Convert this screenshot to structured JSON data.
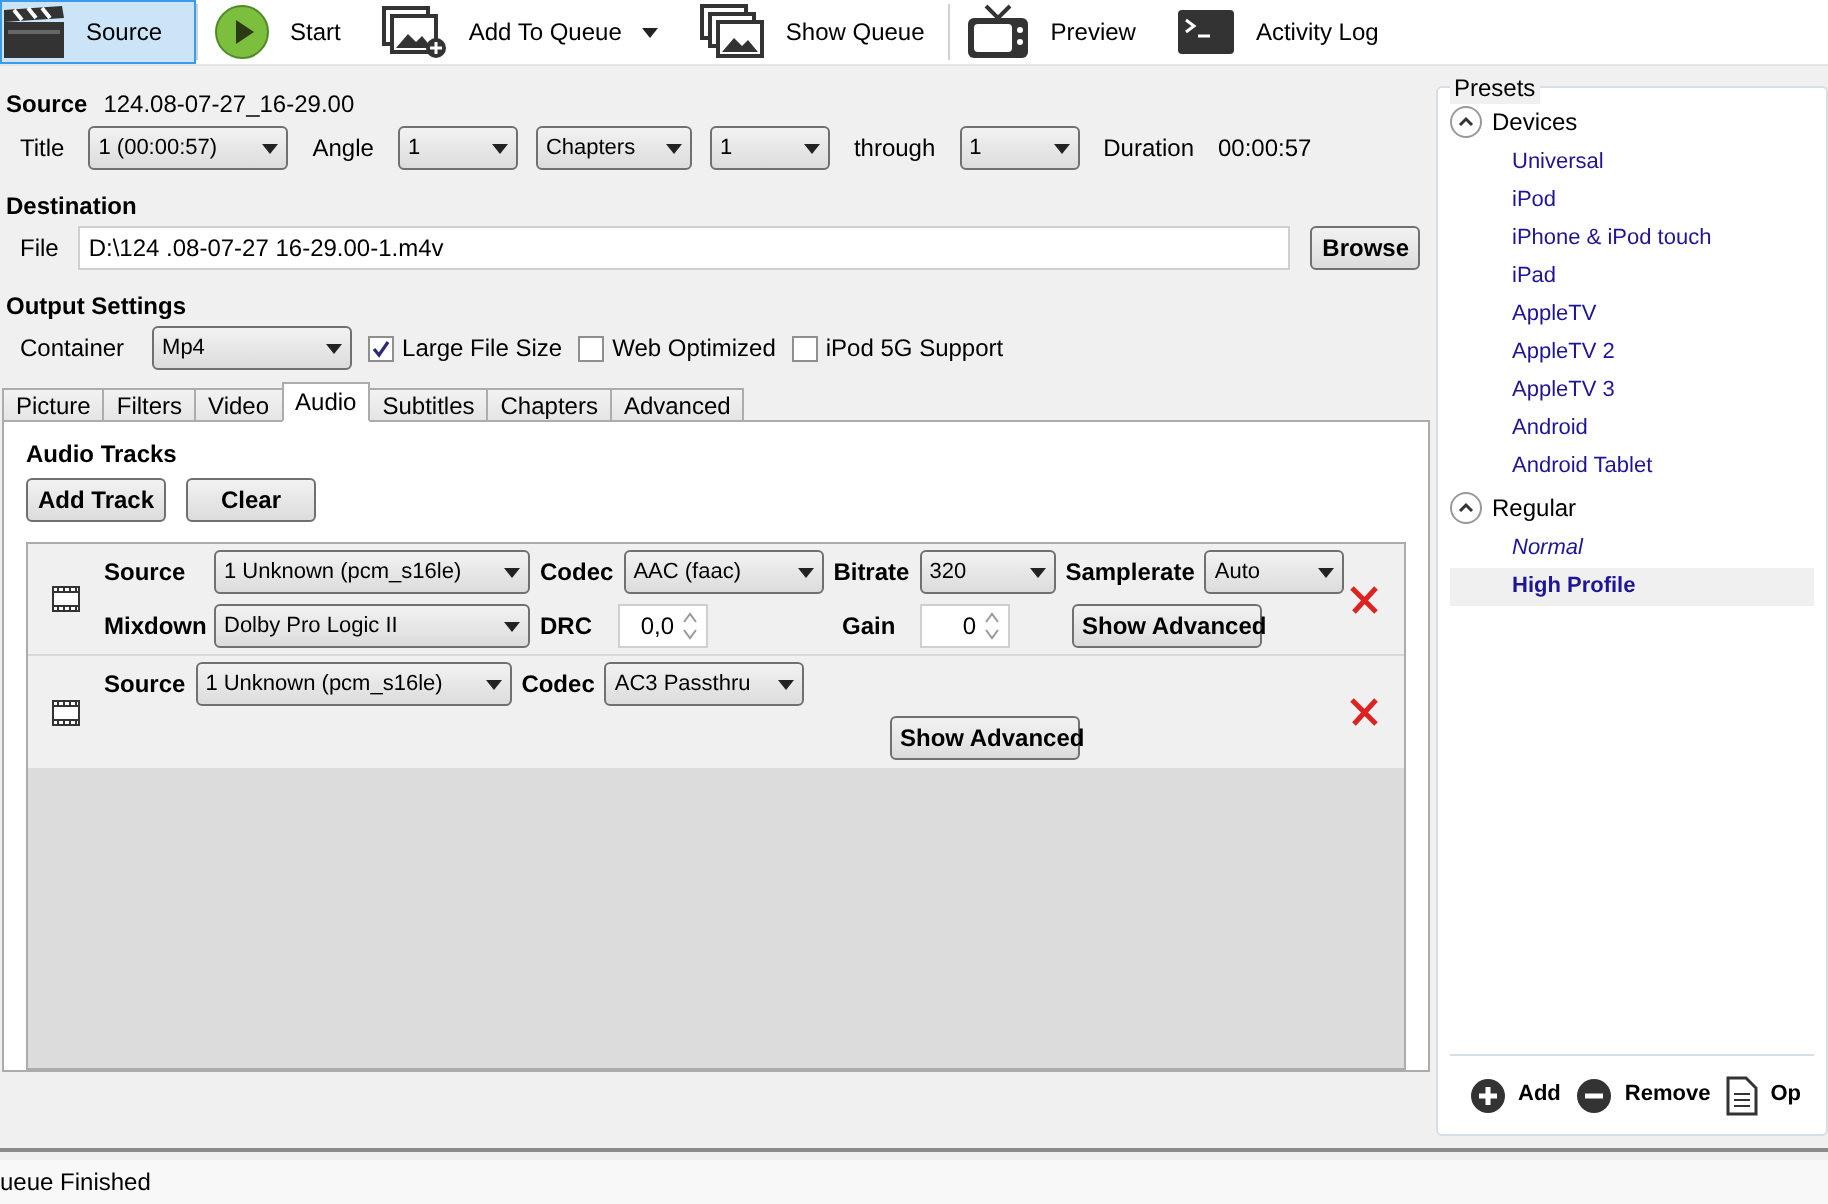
{
  "toolbar": [
    {
      "kind": "source",
      "label": "Source",
      "selected": true,
      "dropdown": false
    },
    {
      "kind": "start",
      "label": "Start",
      "selected": false,
      "dropdown": false
    },
    {
      "kind": "add_queue",
      "label": "Add To Queue",
      "selected": false,
      "dropdown": true
    },
    {
      "kind": "show_queue",
      "label": "Show Queue",
      "selected": false,
      "dropdown": false
    },
    {
      "kind": "preview",
      "label": "Preview",
      "selected": false,
      "dropdown": false
    },
    {
      "kind": "log",
      "label": "Activity Log",
      "selected": false,
      "dropdown": false
    }
  ],
  "source": {
    "label": "Source",
    "value": "124.08-07-27_16-29.00"
  },
  "title_row": {
    "title_label": "Title",
    "title": "1 (00:00:57)",
    "angle_label": "Angle",
    "angle": "1",
    "range_mode": "Chapters",
    "start": "1",
    "through_label": "through",
    "end": "1",
    "duration_label": "Duration",
    "duration": "00:00:57"
  },
  "destination": {
    "heading": "Destination",
    "file_label": "File",
    "file": "D:\\124 .08-07-27 16-29.00-1.m4v",
    "browse": "Browse"
  },
  "output": {
    "heading": "Output Settings",
    "container_label": "Container",
    "container": "Mp4",
    "options": [
      {
        "label": "Large File Size",
        "checked": true
      },
      {
        "label": "Web Optimized",
        "checked": false
      },
      {
        "label": "iPod 5G Support",
        "checked": false
      }
    ]
  },
  "tabs": [
    {
      "label": "Picture",
      "selected": false
    },
    {
      "label": "Filters",
      "selected": false
    },
    {
      "label": "Video",
      "selected": false
    },
    {
      "label": "Audio",
      "selected": true
    },
    {
      "label": "Subtitles",
      "selected": false
    },
    {
      "label": "Chapters",
      "selected": false
    },
    {
      "label": "Advanced",
      "selected": false
    }
  ],
  "audio": {
    "heading": "Audio Tracks",
    "add": "Add Track",
    "clear": "Clear",
    "tracks": [
      {
        "kind": "encode",
        "source_label": "Source",
        "source": "1 Unknown (pcm_s16le)",
        "codec_label": "Codec",
        "codec": "AAC (faac)",
        "bitrate_label": "Bitrate",
        "bitrate": "320",
        "samplerate_label": "Samplerate",
        "samplerate": "Auto",
        "mixdown_label": "Mixdown",
        "mixdown": "Dolby Pro Logic II",
        "drc_label": "DRC",
        "drc": "0,0",
        "gain_label": "Gain",
        "gain": "0",
        "advanced": "Show Advanced"
      },
      {
        "kind": "passthru",
        "source_label": "Source",
        "source": "1 Unknown (pcm_s16le)",
        "codec_label": "Codec",
        "codec": "AC3 Passthru",
        "advanced": "Show Advanced"
      }
    ]
  },
  "presets": {
    "heading": "Presets",
    "groups": [
      {
        "label": "Devices",
        "expanded": true,
        "items": [
          {
            "label": "Universal",
            "default": false,
            "selected": false
          },
          {
            "label": "iPod",
            "default": false,
            "selected": false
          },
          {
            "label": "iPhone & iPod touch",
            "default": false,
            "selected": false
          },
          {
            "label": "iPad",
            "default": false,
            "selected": false
          },
          {
            "label": "AppleTV",
            "default": false,
            "selected": false
          },
          {
            "label": "AppleTV 2",
            "default": false,
            "selected": false
          },
          {
            "label": "AppleTV 3",
            "default": false,
            "selected": false
          },
          {
            "label": "Android",
            "default": false,
            "selected": false
          },
          {
            "label": "Android Tablet",
            "default": false,
            "selected": false
          }
        ]
      },
      {
        "label": "Regular",
        "expanded": true,
        "items": [
          {
            "label": "Normal",
            "default": true,
            "selected": false
          },
          {
            "label": "High Profile",
            "default": false,
            "selected": true
          }
        ]
      }
    ],
    "actions": [
      {
        "kind": "add",
        "label": "Add"
      },
      {
        "kind": "remove",
        "label": "Remove"
      },
      {
        "kind": "options",
        "label": "Op"
      }
    ]
  },
  "status_bar": "ueue Finished"
}
